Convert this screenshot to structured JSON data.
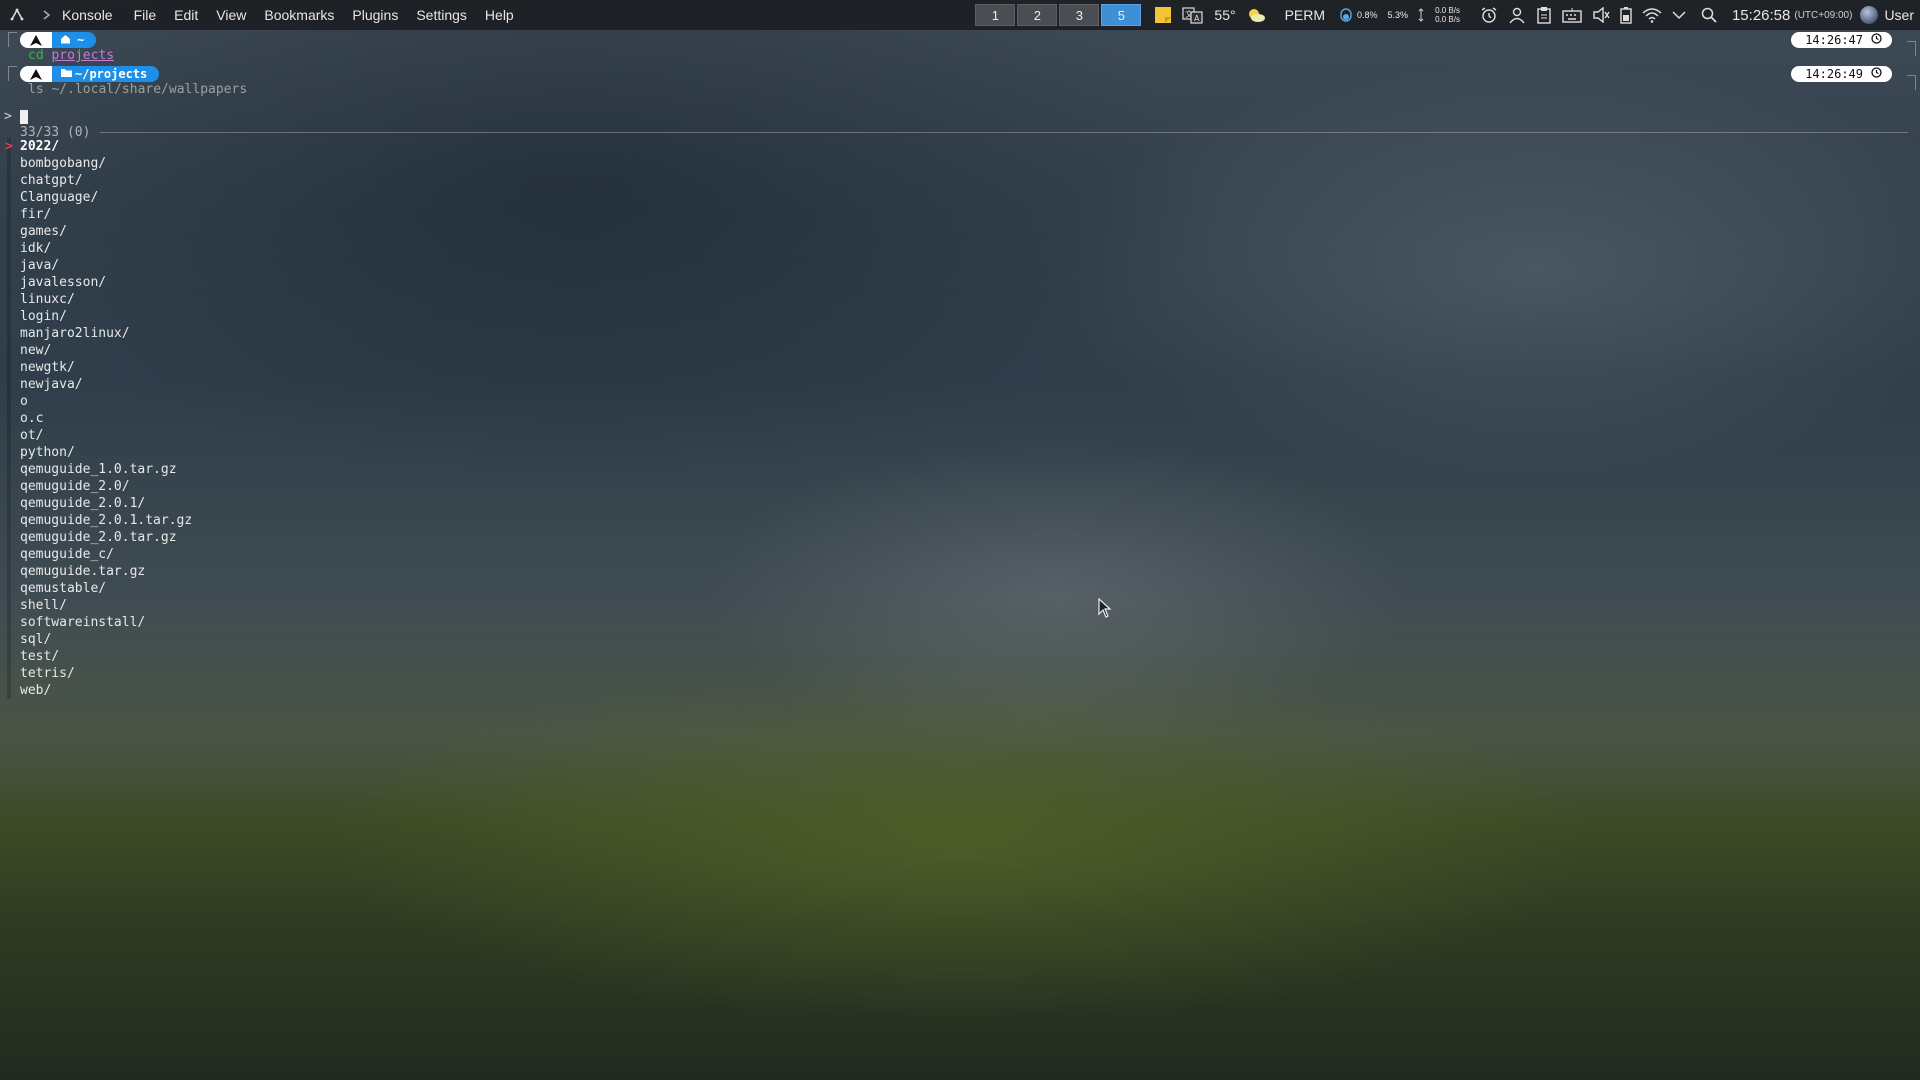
{
  "panel": {
    "app_name": "Konsole",
    "menu": [
      "File",
      "Edit",
      "View",
      "Bookmarks",
      "Plugins",
      "Settings",
      "Help"
    ],
    "workspaces": [
      "1",
      "2",
      "3",
      "5"
    ],
    "active_workspace": "5",
    "temperature": "55°",
    "perm": "PERM",
    "cpu": "0.8%",
    "mem": "5.3%",
    "net_up": "0.0 B/s",
    "net_down": "0.0 B/s",
    "clock": "15:26:58",
    "timezone": "(UTC+09:00)",
    "user": "User",
    "icons": [
      "launcher-icon",
      "konsole-icon",
      "sticky-note-icon",
      "translate-icon",
      "weather-icon",
      "cpu-icon",
      "network-icon",
      "alarm-icon",
      "user-icon",
      "clipboard-icon",
      "keyboard-icon",
      "volume-icon",
      "battery-icon",
      "wifi-icon",
      "chevron-down-icon",
      "search-icon"
    ]
  },
  "terminal": {
    "prompts": [
      {
        "dir": "~",
        "command": "cd",
        "arg": "projects",
        "time": "14:26:47"
      },
      {
        "dir": "~/projects",
        "command": "ls",
        "arg": "~/.local/share/wallpapers",
        "time": "14:26:49"
      }
    ],
    "fzf_prompt": ">",
    "info": "33/33 (0)",
    "items": [
      "2022/",
      "bombgobang/",
      "chatgpt/",
      "Clanguage/",
      "fir/",
      "games/",
      "idk/",
      "java/",
      "javalesson/",
      "linuxc/",
      "login/",
      "manjaro2linux/",
      "new/",
      "newgtk/",
      "newjava/",
      "o",
      "o.c",
      "ot/",
      "python/",
      "qemuguide_1.0.tar.gz",
      "qemuguide_2.0/",
      "qemuguide_2.0.1/",
      "qemuguide_2.0.1.tar.gz",
      "qemuguide_2.0.tar.gz",
      "qemuguide_c/",
      "qemuguide.tar.gz",
      "qemustable/",
      "shell/",
      "softwareinstall/",
      "sql/",
      "test/",
      "tetris/",
      "web/"
    ],
    "selected_index": 0,
    "selected_marker": ">"
  }
}
